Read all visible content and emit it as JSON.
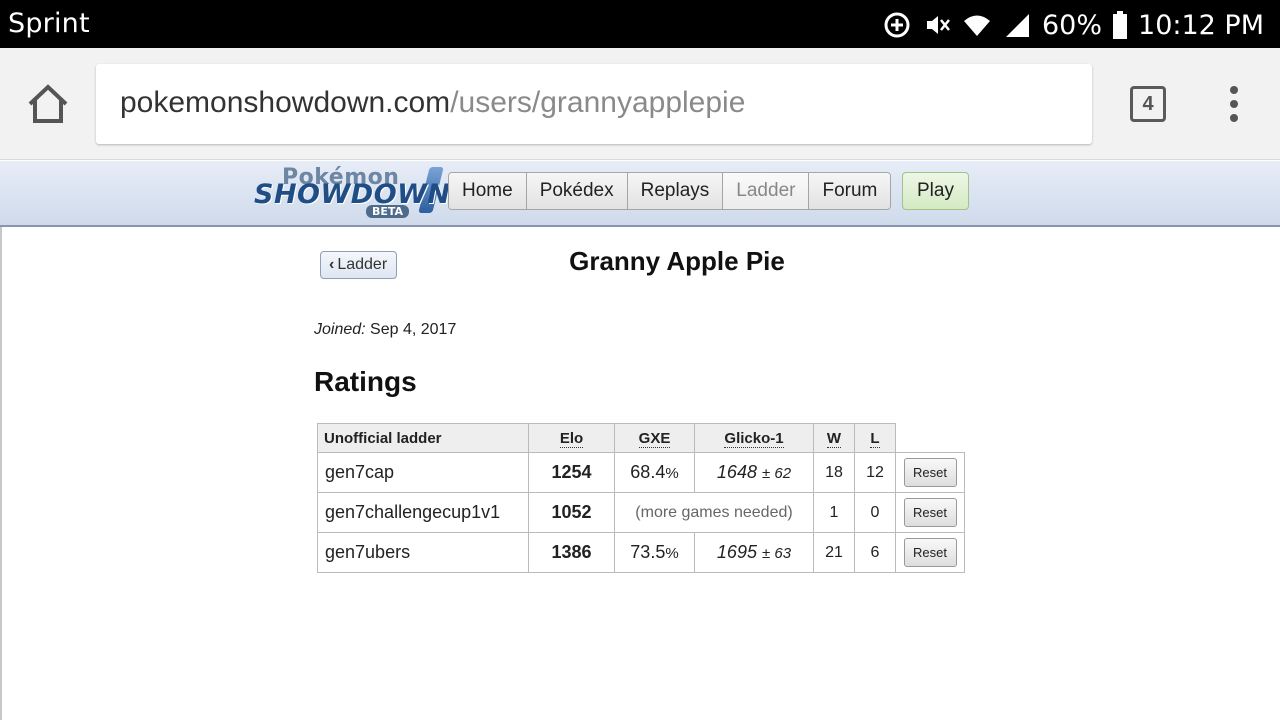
{
  "status_bar": {
    "carrier": "Sprint",
    "battery": "60%",
    "time": "10:12 PM",
    "icons": [
      "data-saver-icon",
      "mute-icon",
      "wifi-icon",
      "signal-icon",
      "battery-icon"
    ]
  },
  "browser": {
    "url_domain": "pokemonshowdown.com",
    "url_path": "/users/grannyapplepie",
    "tab_count": "4"
  },
  "site_header": {
    "logo": {
      "line1": "Pokémon",
      "line2": "SHOWDOWN",
      "badge": "BETA"
    },
    "nav": [
      "Home",
      "Pokédex",
      "Replays",
      "Ladder",
      "Forum"
    ],
    "current_nav": "Ladder",
    "play_label": "Play"
  },
  "profile": {
    "back_label": "Ladder",
    "username": "Granny Apple Pie",
    "joined_label": "Joined:",
    "joined_date": "Sep 4, 2017",
    "ratings_heading": "Ratings"
  },
  "ratings_table": {
    "headers": {
      "format": "Unofficial ladder",
      "elo": "Elo",
      "gxe": "GXE",
      "glicko": "Glicko-1",
      "w": "W",
      "l": "L"
    },
    "rows": [
      {
        "format": "gen7cap",
        "elo": "1254",
        "gxe": "68.4",
        "gxe_unit": "%",
        "glicko": "1648",
        "glicko_dev": "± 62",
        "w": "18",
        "l": "12",
        "reset": "Reset"
      },
      {
        "format": "gen7challengecup1v1",
        "elo": "1052",
        "note": "(more games needed)",
        "w": "1",
        "l": "0",
        "reset": "Reset"
      },
      {
        "format": "gen7ubers",
        "elo": "1386",
        "gxe": "73.5",
        "gxe_unit": "%",
        "glicko": "1695",
        "glicko_dev": "± 63",
        "w": "21",
        "l": "6",
        "reset": "Reset"
      }
    ]
  },
  "colors": {
    "header_gradient_top": "#e7edf7",
    "header_gradient_bottom": "#cfdaeb",
    "logo_blue": "#1f4e86",
    "play_green": "#d3eac3"
  }
}
